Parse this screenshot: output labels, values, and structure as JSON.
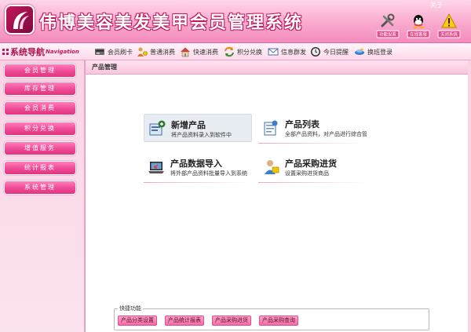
{
  "header": {
    "title": "伟博美容美发美甲会员管理系统",
    "about": "关于",
    "tools": [
      {
        "label": "功能设置",
        "icon": "tools-icon"
      },
      {
        "label": "在线客服",
        "icon": "qq-icon"
      },
      {
        "label": "关闭系统",
        "icon": "warning-icon"
      }
    ]
  },
  "nav_title": {
    "cn": "系统导航",
    "en": "Navigation"
  },
  "toolbar": [
    {
      "label": "会员刷卡",
      "icon": "card-reader-icon"
    },
    {
      "label": "普通消费",
      "icon": "person-coin-icon"
    },
    {
      "label": "快速消费",
      "icon": "house-icon"
    },
    {
      "label": "积分兑换",
      "icon": "exchange-icon"
    },
    {
      "label": "信息群发",
      "icon": "envelope-icon"
    },
    {
      "label": "今日提醒",
      "icon": "clock-icon"
    },
    {
      "label": "换班登录",
      "icon": "shift-login-icon"
    }
  ],
  "sidebar": [
    {
      "label": "会员管理"
    },
    {
      "label": "库存管理"
    },
    {
      "label": "会员消费"
    },
    {
      "label": "积分兑换"
    },
    {
      "label": "增值服务"
    },
    {
      "label": "统计报表"
    },
    {
      "label": "系统管理"
    }
  ],
  "content": {
    "heading": "产品管理",
    "functions": [
      {
        "title": "新增产品",
        "desc": "将产品资料录入到软件中",
        "icon": "add-product-icon"
      },
      {
        "title": "产品列表",
        "desc": "全部产品资料，对产品进行综合管",
        "icon": "product-list-icon"
      },
      {
        "title": "产品数据导入",
        "desc": "将外部产品资料批量导入到系统",
        "icon": "laptop-import-icon"
      },
      {
        "title": "产品采购进货",
        "desc": "设置采购进货商品",
        "icon": "purchase-user-icon"
      }
    ],
    "quick": {
      "legend": "快捷功能",
      "buttons": [
        "产品分类设置",
        "产品统计报表",
        "产品采购进货",
        "产品采购查询"
      ]
    }
  },
  "colors": {
    "accent": "#e2337f",
    "header": "#f9a9cd",
    "highlight": "#e8edf3"
  }
}
